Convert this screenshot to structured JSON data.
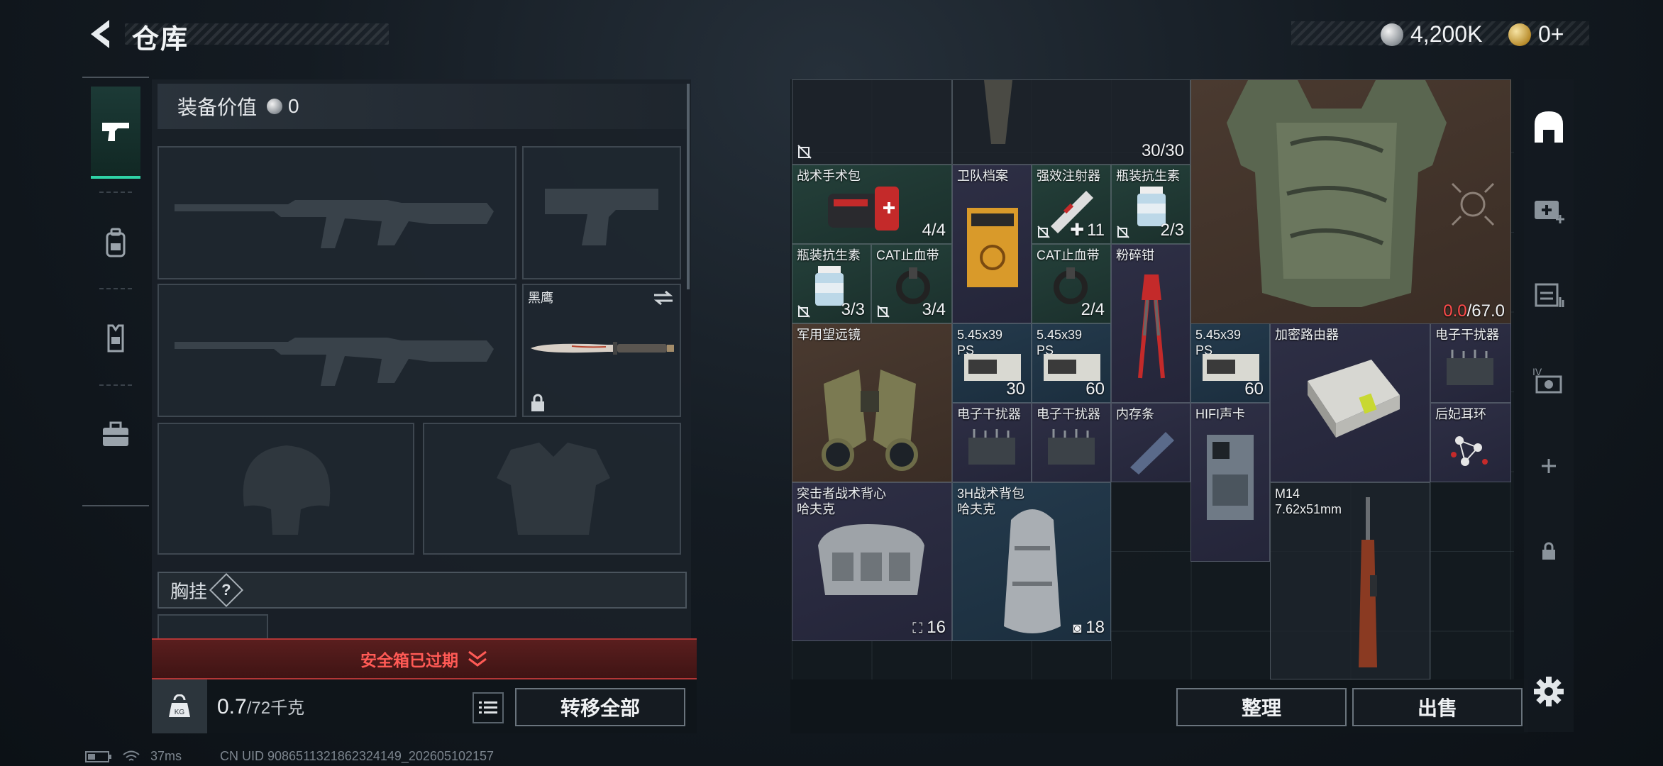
{
  "header": {
    "title": "仓库",
    "currencies": [
      {
        "icon": "silver-coin-icon",
        "value": "4,200K"
      },
      {
        "icon": "gold-coin-icon",
        "value": "0+"
      }
    ]
  },
  "loadout": {
    "value_label": "装备价值",
    "value": "0",
    "melee_slot_label": "黑鹰",
    "chest_rig_label": "胸挂",
    "chest_rig_help": "?",
    "safebox_status": "安全箱已过期",
    "weight_current": "0.7",
    "weight_max": "/72千克",
    "transfer_all_label": "转移全部"
  },
  "left_tabs": [
    {
      "name": "weapon-tab",
      "icon": "pistol-icon",
      "active": true
    },
    {
      "name": "armor-tab",
      "icon": "backpack-icon",
      "active": false
    },
    {
      "name": "rig-tab",
      "icon": "vest-icon",
      "active": false
    },
    {
      "name": "case-tab",
      "icon": "briefcase-icon",
      "active": false
    }
  ],
  "storage": {
    "items": [
      {
        "name": "",
        "count": "",
        "color": "dark",
        "tag": "no-sell"
      },
      {
        "name": "",
        "count": "30/30",
        "color": "dark"
      },
      {
        "name": "",
        "count_red": "0.0",
        "count": "/67.0",
        "color": "brown"
      },
      {
        "name": "战术手术包",
        "count": "4/4",
        "color": "green"
      },
      {
        "name": "卫队档案",
        "count": "",
        "color": "purple"
      },
      {
        "name": "强效注射器",
        "count": "11",
        "color": "green"
      },
      {
        "name": "瓶装抗生素",
        "count": "2/3",
        "color": "green"
      },
      {
        "name": "瓶装抗生素",
        "count": "3/3",
        "color": "green"
      },
      {
        "name": "CAT止血带",
        "count": "3/4",
        "color": "green"
      },
      {
        "name": "CAT止血带",
        "count": "2/4",
        "color": "green"
      },
      {
        "name": "粉碎钳",
        "count": "",
        "color": "purple"
      },
      {
        "name": "军用望远镜",
        "count": "",
        "color": "brown"
      },
      {
        "name": "5.45x39 PS",
        "count": "30",
        "color": "blue"
      },
      {
        "name": "5.45x39 PS",
        "count": "60",
        "color": "blue"
      },
      {
        "name": "5.45x39 PS",
        "count": "60",
        "color": "blue"
      },
      {
        "name": "加密路由器",
        "count": "",
        "color": "purple"
      },
      {
        "name": "电子干扰器",
        "count": "",
        "color": "purple"
      },
      {
        "name": "电子干扰器",
        "count": "",
        "color": "purple"
      },
      {
        "name": "电子干扰器",
        "count": "",
        "color": "purple"
      },
      {
        "name": "内存条",
        "count": "",
        "color": "purple"
      },
      {
        "name": "HIFI声卡",
        "count": "",
        "color": "purple"
      },
      {
        "name": "后妃耳环",
        "count": "",
        "color": "purple"
      },
      {
        "name": "突击者战术背心",
        "sub": "哈夫克",
        "count": "16",
        "color": "purple"
      },
      {
        "name": "3H战术背包",
        "sub": "哈夫克",
        "count": "18",
        "color": "blue"
      },
      {
        "name": "M14",
        "sub": "7.62x51mm",
        "count": "",
        "color": "dark"
      }
    ],
    "sort_label": "整理",
    "sell_label": "出售"
  },
  "right_rail": [
    "home-icon",
    "add-medkit-icon",
    "storage-icon",
    "extension-icon",
    "plus-icon",
    "lock-icon",
    "settings-icon"
  ],
  "status_bar": {
    "ping": "37ms",
    "uid": "CN UID 9086511321862324149_202605102157"
  }
}
